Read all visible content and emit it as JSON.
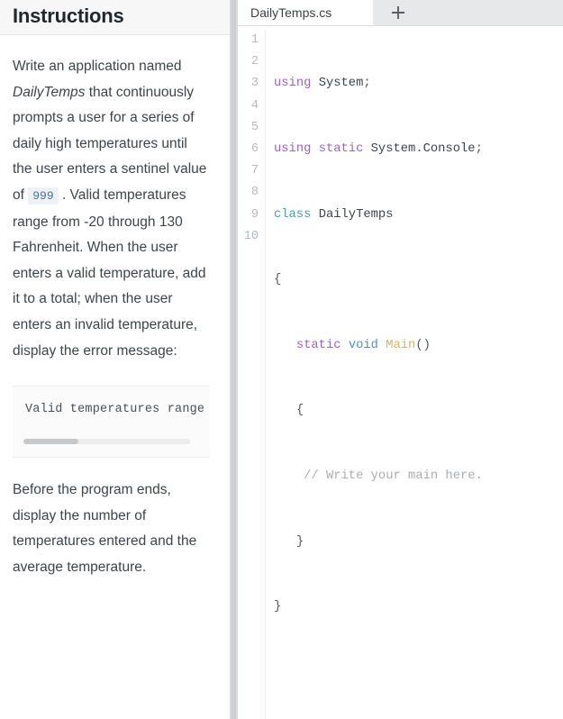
{
  "instructions": {
    "title": "Instructions",
    "paragraph1_parts": {
      "before_em": "Write an application named ",
      "em": "DailyTemps",
      "after_em": " that continuously prompts a user for a series of daily high temperatures until the user enters a sentinel value of ",
      "inline_code": "999",
      "tail": " . Valid temperatures range from -20 through 130 Fahrenheit. When the user enters a valid temperature, add it to a total; when the user enters an invalid temperature, display the error message:"
    },
    "code_block": "Valid temperatures range",
    "paragraph2": "Before the program ends, display the number of temperatures entered and the average temperature.",
    "scrollbar": {
      "thumb_percent": 33
    }
  },
  "editor": {
    "tabs": [
      {
        "label": "DailyTemps.cs",
        "active": true
      }
    ],
    "new_tab_label": "+",
    "line_numbers": [
      "1",
      "2",
      "3",
      "4",
      "5",
      "6",
      "7",
      "8",
      "9",
      "10"
    ],
    "lines": [
      {
        "n": "1",
        "text": "using System;"
      },
      {
        "n": "2",
        "text": "using static System.Console;"
      },
      {
        "n": "3",
        "text": "class DailyTemps"
      },
      {
        "n": "4",
        "text": "{"
      },
      {
        "n": "5",
        "text": "   static void Main()"
      },
      {
        "n": "6",
        "text": "   {"
      },
      {
        "n": "7",
        "text": "    // Write your main here."
      },
      {
        "n": "8",
        "text": "   }"
      },
      {
        "n": "9",
        "text": "}"
      },
      {
        "n": "10",
        "text": ""
      }
    ]
  },
  "colors": {
    "keyword": "#9a63cd",
    "type": "#4a9bb5",
    "method": "#d6b45c",
    "comment": "#a9acb0",
    "text": "#3f4448",
    "inline_code_bg": "#eef1f5",
    "inline_code_fg": "#46739c",
    "header_bg": "#f7f7f8",
    "tabbar_bg": "#e7e8ea"
  }
}
